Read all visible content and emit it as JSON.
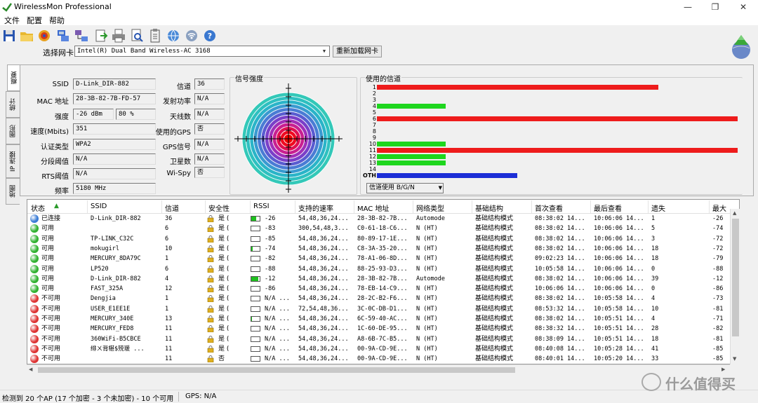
{
  "window": {
    "title": "WirelessMon Professional",
    "minimize": "—",
    "maximize": "❐",
    "close": "✕"
  },
  "menu": [
    "文件",
    "配置",
    "帮助"
  ],
  "toolbar_icons": [
    "save-icon",
    "open-folder-icon",
    "record-icon",
    "network-cards-icon",
    "connections-icon",
    "export-icon",
    "print-icon",
    "print-preview-icon",
    "clipboard-icon",
    "web-icon",
    "wireless-icon",
    "help-icon"
  ],
  "card": {
    "label": "选择网卡",
    "value": "Intel(R) Dual Band Wireless-AC 3168",
    "reload": "重新加载网卡"
  },
  "side_tabs": [
    "概要",
    "统计",
    "图形",
    "IP 连接",
    "地图"
  ],
  "summary": {
    "ssid_label": "SSID",
    "ssid": "D-Link_DIR-882",
    "mac_label": "MAC 地址",
    "mac": "28-3B-82-7B-FD-57",
    "strength_label": "强度",
    "strength_dbm": "-26 dBm",
    "strength_pct": "80 %",
    "speed_label": "速度(Mbits)",
    "speed": "351",
    "auth_label": "认证类型",
    "auth": "WPA2",
    "frag_label": "分段阈值",
    "frag": "N/A",
    "rts_label": "RTS阈值",
    "rts": "N/A",
    "freq_label": "频率",
    "freq": "5180 MHz",
    "channel_label": "信道",
    "channel": "36",
    "txpower_label": "发射功率",
    "txpower": "N/A",
    "antennas_label": "天线数",
    "antennas": "N/A",
    "gps_use_label": "使用的GPS",
    "gps_use": "否",
    "gps_signal_label": "GPS信号",
    "gps_signal": "N/A",
    "satellites_label": "卫星数",
    "satellites": "N/A",
    "wispy_label": "Wi-Spy",
    "wispy": "否"
  },
  "signal_title": "信号强度",
  "channels": {
    "title": "使用的信道",
    "labels": [
      "1",
      "2",
      "3",
      "4",
      "5",
      "6",
      "7",
      "8",
      "9",
      "10",
      "11",
      "12",
      "13",
      "14",
      "OTH"
    ],
    "values": [
      78,
      0,
      0,
      19,
      0,
      100,
      0,
      0,
      0,
      19,
      100,
      19,
      19,
      0,
      39
    ],
    "colors": [
      "#ee1c1c",
      "#ee1c1c",
      "#ee1c1c",
      "#1ed61e",
      "#ee1c1c",
      "#ee1c1c",
      "#ee1c1c",
      "#ee1c1c",
      "#ee1c1c",
      "#1ed61e",
      "#ee1c1c",
      "#1ed61e",
      "#1ed61e",
      "#ee1c1c",
      "#1c2ed6"
    ],
    "usage_select": "信道使用 B/G/N"
  },
  "table": {
    "headers": [
      "状态",
      "SSID",
      "信道",
      "安全性",
      "RSSI",
      "支持的速率",
      "MAC 地址",
      "网络类型",
      "基础结构",
      "首次查看",
      "最后查看",
      "遗失",
      "最大"
    ],
    "rows": [
      {
        "status": "已连接",
        "color": "#3a7bd5",
        "ssid": "D-Link_DIR-882",
        "ch": "36",
        "sec": "是 (",
        "rssi": "-26",
        "rssi_level": 0.6,
        "rates": "54,48,36,24...",
        "mac": "28-3B-82-7B...",
        "nettype": "Automode",
        "infra": "基础结构模式",
        "first": "08:38:02 14...",
        "last": "10:06:06 14...",
        "lost": "1",
        "max": "-26"
      },
      {
        "status": "可用",
        "color": "#2fb12f",
        "ssid": "",
        "ch": "6",
        "sec": "是 (",
        "rssi": "-83",
        "rssi_level": 0,
        "rates": "300,54,48,3...",
        "mac": "C0-61-18-C6...",
        "nettype": "N (HT)",
        "infra": "基础结构模式",
        "first": "08:38:02 14...",
        "last": "10:06:06 14...",
        "lost": "5",
        "max": "-74"
      },
      {
        "status": "可用",
        "color": "#2fb12f",
        "ssid": "TP-LINK_C32C",
        "ch": "6",
        "sec": "是 (",
        "rssi": "-85",
        "rssi_level": 0,
        "rates": "54,48,36,24...",
        "mac": "80-89-17-1E...",
        "nettype": "N (HT)",
        "infra": "基础结构模式",
        "first": "08:38:02 14...",
        "last": "10:06:06 14...",
        "lost": "3",
        "max": "-72"
      },
      {
        "status": "可用",
        "color": "#2fb12f",
        "ssid": "mokugirl",
        "ch": "10",
        "sec": "是 (",
        "rssi": "-74",
        "rssi_level": 0.15,
        "rates": "54,48,36,24...",
        "mac": "C8-3A-35-20...",
        "nettype": "N (HT)",
        "infra": "基础结构模式",
        "first": "08:38:02 14...",
        "last": "10:06:06 14...",
        "lost": "18",
        "max": "-72"
      },
      {
        "status": "可用",
        "color": "#2fb12f",
        "ssid": "MERCURY_8DA79C",
        "ch": "1",
        "sec": "是 (",
        "rssi": "-82",
        "rssi_level": 0,
        "rates": "54,48,36,24...",
        "mac": "78-A1-06-8D...",
        "nettype": "N (HT)",
        "infra": "基础结构模式",
        "first": "09:02:23 14...",
        "last": "10:06:06 14...",
        "lost": "18",
        "max": "-79"
      },
      {
        "status": "可用",
        "color": "#2fb12f",
        "ssid": "LP520",
        "ch": "6",
        "sec": "是 (",
        "rssi": "-88",
        "rssi_level": 0,
        "rates": "54,48,36,24...",
        "mac": "88-25-93-D3...",
        "nettype": "N (HT)",
        "infra": "基础结构模式",
        "first": "10:05:58 14...",
        "last": "10:06:06 14...",
        "lost": "0",
        "max": "-88"
      },
      {
        "status": "可用",
        "color": "#2fb12f",
        "ssid": "D-Link_DIR-882",
        "ch": "4",
        "sec": "是 (",
        "rssi": "-12",
        "rssi_level": 0.8,
        "rates": "54,48,36,24...",
        "mac": "28-3B-82-7B...",
        "nettype": "Automode",
        "infra": "基础结构模式",
        "first": "08:38:02 14...",
        "last": "10:06:06 14...",
        "lost": "39",
        "max": "-12"
      },
      {
        "status": "可用",
        "color": "#2fb12f",
        "ssid": "FAST_325A",
        "ch": "12",
        "sec": "是 (",
        "rssi": "-86",
        "rssi_level": 0,
        "rates": "54,48,36,24...",
        "mac": "78-EB-14-C9...",
        "nettype": "N (HT)",
        "infra": "基础结构模式",
        "first": "10:06:06 14...",
        "last": "10:06:06 14...",
        "lost": "0",
        "max": "-86"
      },
      {
        "status": "不可用",
        "color": "#dd3333",
        "ssid": "Dengjia",
        "ch": "1",
        "sec": "是 (",
        "rssi": "N/A ...",
        "rssi_level": 0,
        "rates": "54,48,36,24...",
        "mac": "28-2C-B2-F6...",
        "nettype": "N (HT)",
        "infra": "基础结构模式",
        "first": "08:38:02 14...",
        "last": "10:05:58 14...",
        "lost": "4",
        "max": "-73"
      },
      {
        "status": "不可用",
        "color": "#dd3333",
        "ssid": "USER_E1EE1E",
        "ch": "1",
        "sec": "是 (",
        "rssi": "N/A ...",
        "rssi_level": 0,
        "rates": "72,54,48,36...",
        "mac": "3C-0C-DB-D1...",
        "nettype": "N (HT)",
        "infra": "基础结构模式",
        "first": "08:53:32 14...",
        "last": "10:05:58 14...",
        "lost": "10",
        "max": "-81"
      },
      {
        "status": "不可用",
        "color": "#dd3333",
        "ssid": "MERCURY_340E",
        "ch": "13",
        "sec": "是 (",
        "rssi": "N/A ...",
        "rssi_level": 0.05,
        "rates": "54,48,36,24...",
        "mac": "6C-59-40-AC...",
        "nettype": "N (HT)",
        "infra": "基础结构模式",
        "first": "08:38:02 14...",
        "last": "10:05:51 14...",
        "lost": "4",
        "max": "-71"
      },
      {
        "status": "不可用",
        "color": "#dd3333",
        "ssid": "MERCURY_FED8",
        "ch": "11",
        "sec": "是 (",
        "rssi": "N/A ...",
        "rssi_level": 0,
        "rates": "54,48,36,24...",
        "mac": "1C-60-DE-95...",
        "nettype": "N (HT)",
        "infra": "基础结构模式",
        "first": "08:38:32 14...",
        "last": "10:05:51 14...",
        "lost": "28",
        "max": "-82"
      },
      {
        "status": "不可用",
        "color": "#dd3333",
        "ssid": "360WiFi-B5CBCE",
        "ch": "11",
        "sec": "是 (",
        "rssi": "N/A ...",
        "rssi_level": 0,
        "rates": "54,48,36,24...",
        "mac": "A8-6B-7C-B5...",
        "nettype": "N (HT)",
        "infra": "基础结构模式",
        "first": "08:38:09 14...",
        "last": "10:05:51 14...",
        "lost": "18",
        "max": "-81"
      },
      {
        "status": "不可用",
        "color": "#dd3333",
        "ssid": "绯ㄨ背椹$殑瑗  ...",
        "ch": "11",
        "sec": "是 (",
        "rssi": "N/A ...",
        "rssi_level": 0,
        "rates": "54,48,36,24...",
        "mac": "00-9A-CD-9E...",
        "nettype": "N (HT)",
        "infra": "基础结构模式",
        "first": "08:40:08 14...",
        "last": "10:05:28 14...",
        "lost": "41",
        "max": "-85"
      },
      {
        "status": "不可用",
        "color": "#dd3333",
        "ssid": "",
        "ch": "11",
        "sec": "否",
        "rssi": "N/A ...",
        "rssi_level": 0,
        "rates": "54,48,36,24...",
        "mac": "00-9A-CD-9E...",
        "nettype": "N (HT)",
        "infra": "基础结构模式",
        "first": "08:40:01 14...",
        "last": "10:05:20 14...",
        "lost": "33",
        "max": "-85"
      }
    ]
  },
  "status": {
    "main": "检测到 20 个AP (17 个加密 - 3 个未加密) - 10 个可用",
    "gps": "GPS: N/A"
  },
  "watermark": "什么值得买"
}
